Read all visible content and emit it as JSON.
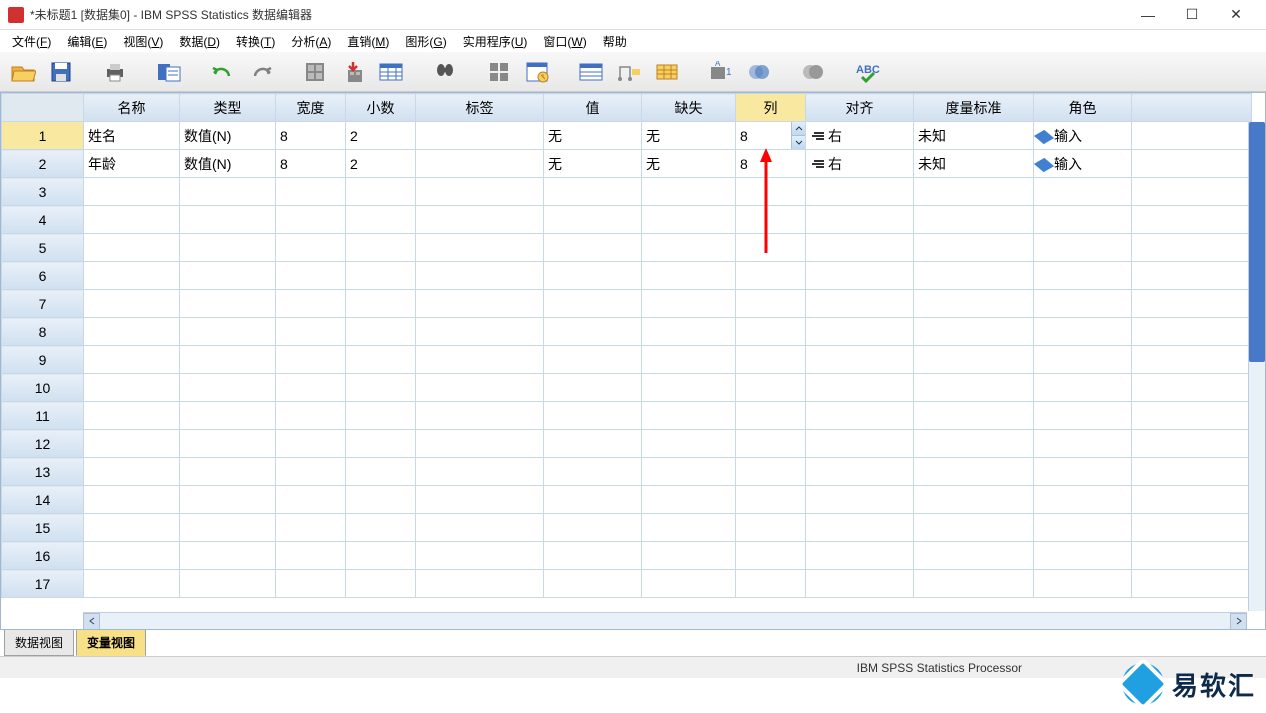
{
  "window": {
    "title": "*未标题1 [数据集0] - IBM SPSS Statistics 数据编辑器",
    "min": "—",
    "max": "☐",
    "close": "✕"
  },
  "menus": [
    {
      "label": "文件",
      "k": "F"
    },
    {
      "label": "编辑",
      "k": "E"
    },
    {
      "label": "视图",
      "k": "V"
    },
    {
      "label": "数据",
      "k": "D"
    },
    {
      "label": "转换",
      "k": "T"
    },
    {
      "label": "分析",
      "k": "A"
    },
    {
      "label": "直销",
      "k": "M"
    },
    {
      "label": "图形",
      "k": "G"
    },
    {
      "label": "实用程序",
      "k": "U"
    },
    {
      "label": "窗口",
      "k": "W"
    },
    {
      "label": "帮助",
      "k": ""
    }
  ],
  "columns": [
    "名称",
    "类型",
    "宽度",
    "小数",
    "标签",
    "值",
    "缺失",
    "列",
    "对齐",
    "度量标准",
    "角色"
  ],
  "selected_col_index": 7,
  "rows": [
    {
      "num": "1",
      "名称": "姓名",
      "类型": "数值(N)",
      "宽度": "8",
      "小数": "2",
      "标签": "",
      "值": "无",
      "缺失": "无",
      "列": "8",
      "对齐": "右",
      "度量标准": "未知",
      "角色": "输入",
      "editing": true
    },
    {
      "num": "2",
      "名称": "年龄",
      "类型": "数值(N)",
      "宽度": "8",
      "小数": "2",
      "标签": "",
      "值": "无",
      "缺失": "无",
      "列": "8",
      "对齐": "右",
      "度量标准": "未知",
      "角色": "输入",
      "editing": false
    }
  ],
  "empty_rows": [
    "3",
    "4",
    "5",
    "6",
    "7",
    "8",
    "9",
    "10",
    "11",
    "12",
    "13",
    "14",
    "15",
    "16",
    "17"
  ],
  "tabs": {
    "data": "数据视图",
    "var": "变量视图",
    "active": "var"
  },
  "statusbar": {
    "processor": "IBM SPSS Statistics Processor"
  },
  "logo": {
    "text": "易软汇"
  }
}
